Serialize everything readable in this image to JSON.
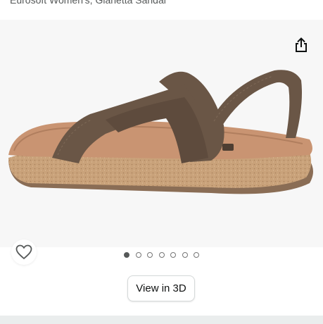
{
  "product": {
    "title": "Eurosoft Women's, Gianetta Sandal"
  },
  "carousel": {
    "image_alt": "Brown leather wedge sandal with cork sole",
    "dot_count": 7,
    "active_index": 0
  },
  "buttons": {
    "view_3d_label": "View in 3D"
  },
  "icons": {
    "share": "share-icon",
    "favorite": "heart-outline-icon"
  },
  "colors": {
    "sandal_strap": "#6a5646",
    "footbed": "#c99472",
    "cork": "#c9a27a"
  }
}
